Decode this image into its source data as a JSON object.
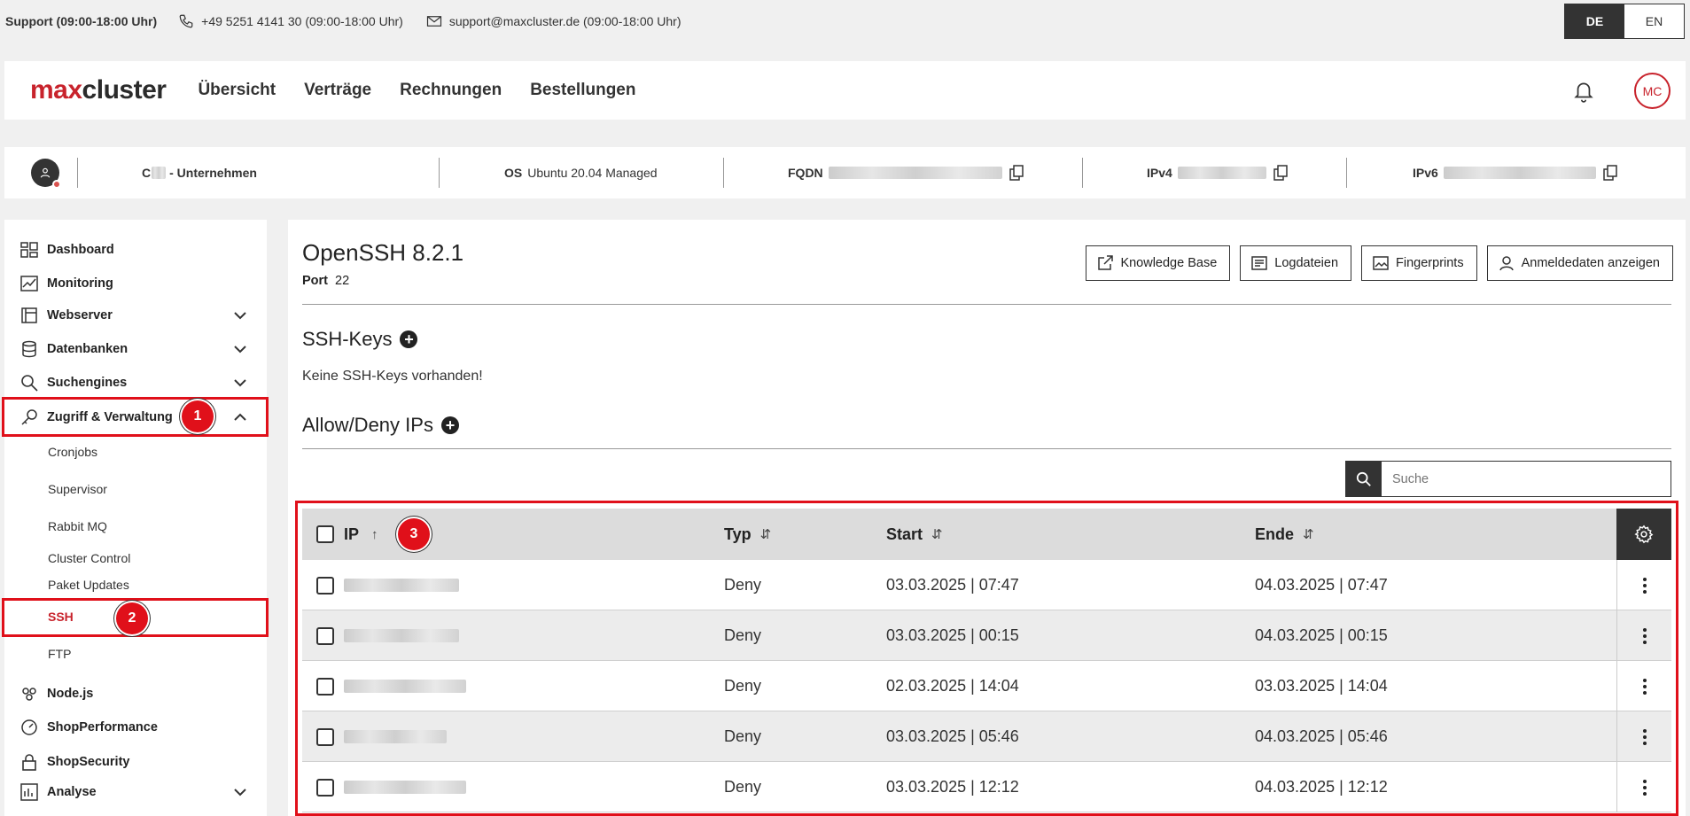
{
  "support": {
    "title": "Support (09:00-18:00 Uhr)",
    "phone": "+49 5251 4141 30 (09:00-18:00 Uhr)",
    "email": "support@maxcluster.de (09:00-18:00 Uhr)"
  },
  "lang": {
    "de": "DE",
    "en": "EN"
  },
  "header": {
    "logo_max": "max",
    "logo_cluster": "cluster",
    "nav": [
      "Übersicht",
      "Verträge",
      "Rechnungen",
      "Bestellungen"
    ],
    "avatar_initials": "MC"
  },
  "server": {
    "customer_prefix": "C",
    "customer_suffix": "- Unternehmen",
    "os_label": "OS",
    "os_value": "Ubuntu 20.04 Managed",
    "fqdn_label": "FQDN",
    "ipv4_label": "IPv4",
    "ipv6_label": "IPv6"
  },
  "sidebar": {
    "items": [
      {
        "label": "Dashboard",
        "icon": "dashboard-icon"
      },
      {
        "label": "Monitoring",
        "icon": "monitoring-icon"
      },
      {
        "label": "Webserver",
        "icon": "webserver-icon"
      },
      {
        "label": "Datenbanken",
        "icon": "database-icon"
      },
      {
        "label": "Suchengines",
        "icon": "search-icon"
      },
      {
        "label": "Zugriff & Verwaltung",
        "icon": "key-icon"
      },
      {
        "label": "Node.js",
        "icon": "nodejs-icon"
      },
      {
        "label": "ShopPerformance",
        "icon": "gauge-icon"
      },
      {
        "label": "ShopSecurity",
        "icon": "lock-icon"
      },
      {
        "label": "Analyse",
        "icon": "analyse-icon"
      }
    ],
    "subitems": [
      "Cronjobs",
      "Supervisor",
      "Rabbit MQ",
      "Cluster Control",
      "Paket Updates",
      "SSH",
      "FTP"
    ]
  },
  "badges": {
    "b1": "1",
    "b2": "2",
    "b3": "3"
  },
  "main": {
    "title": "OpenSSH 8.2.1",
    "port_label": "Port",
    "port_value": "22",
    "buttons": {
      "knowledge": "Knowledge Base",
      "logs": "Logdateien",
      "fingerprints": "Fingerprints",
      "credentials": "Anmeldedaten anzeigen"
    },
    "sshkeys_title": "SSH-Keys",
    "sshkeys_empty": "Keine SSH-Keys vorhanden!",
    "allowdeny_title": "Allow/Deny IPs",
    "search_placeholder": "Suche"
  },
  "table": {
    "headers": {
      "ip": "IP",
      "typ": "Typ",
      "start": "Start",
      "ende": "Ende"
    },
    "rows": [
      {
        "typ": "Deny",
        "start": "03.03.2025 | 07:47",
        "ende": "04.03.2025 | 07:47"
      },
      {
        "typ": "Deny",
        "start": "03.03.2025 | 00:15",
        "ende": "04.03.2025 | 00:15"
      },
      {
        "typ": "Deny",
        "start": "02.03.2025 | 14:04",
        "ende": "03.03.2025 | 14:04"
      },
      {
        "typ": "Deny",
        "start": "03.03.2025 | 05:46",
        "ende": "04.03.2025 | 05:46"
      },
      {
        "typ": "Deny",
        "start": "03.03.2025 | 12:12",
        "ende": "04.03.2025 | 12:12"
      }
    ]
  },
  "colors": {
    "brand_red": "#c8232c",
    "highlight": "#e0101a",
    "dark": "#333333"
  }
}
